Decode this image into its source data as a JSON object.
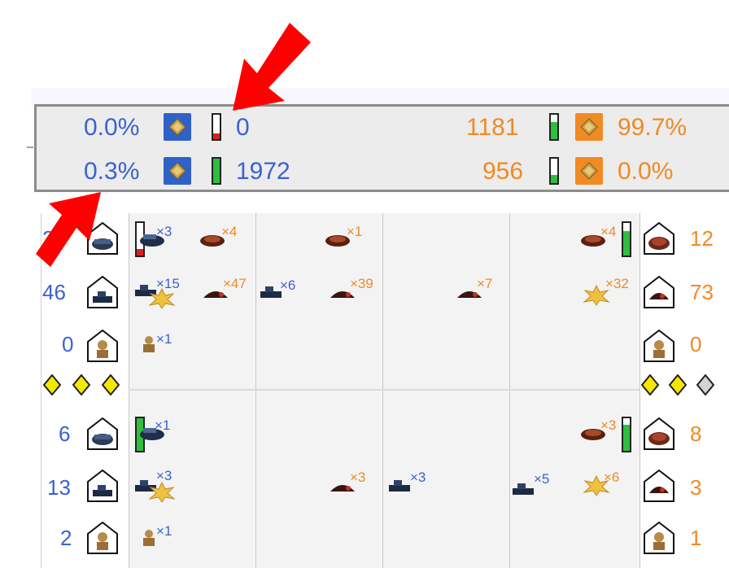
{
  "colors": {
    "blue_team": "#3a62d0",
    "orange_team": "#f08a24",
    "health_green": "#2fbf3f",
    "health_red": "#d92020",
    "annotation_red": "#ff0000"
  },
  "score_panel": {
    "left": {
      "row1": {
        "percent": "0.0%",
        "value": "0",
        "bar_fill": 0.2,
        "bar_color": "red",
        "icon": "gold-diamond-blue-icon"
      },
      "row2": {
        "percent": "0.3%",
        "value": "1972",
        "bar_fill": 1.0,
        "bar_color": "green",
        "icon": "gold-diamond-blue-icon"
      }
    },
    "right": {
      "row1": {
        "value": "1181",
        "percent": "99.7%",
        "bar_fill": 0.7,
        "bar_color": "green",
        "icon": "gold-diamond-orange-icon"
      },
      "row2": {
        "value": "956",
        "percent": "0.0%",
        "bar_fill": 0.35,
        "bar_color": "green",
        "icon": "gold-diamond-orange-icon"
      }
    }
  },
  "lanes": {
    "top": {
      "left_counts": [
        "2",
        "46",
        "0"
      ],
      "right_counts": [
        "12",
        "73",
        "0"
      ],
      "multipliers_blue": [
        "×3",
        "×15",
        "×6",
        "×1"
      ],
      "multipliers_orange": [
        "×4",
        "×1",
        "×4",
        "×47",
        "×39",
        "×7",
        "×32"
      ]
    },
    "bottom": {
      "left_counts": [
        "6",
        "13",
        "2"
      ],
      "right_counts": [
        "8",
        "3",
        "1"
      ],
      "multipliers_blue": [
        "×1",
        "×3",
        "×3",
        "×5",
        "×1"
      ],
      "multipliers_orange": [
        "×3",
        "×3",
        "×6"
      ]
    },
    "left_gems": [
      "yellow",
      "yellow",
      "yellow"
    ],
    "right_gems": [
      "yellow",
      "yellow",
      "gray"
    ]
  },
  "annotations": [
    "red-arrow-top",
    "red-arrow-left-top",
    "red-arrow-left-bottom"
  ]
}
